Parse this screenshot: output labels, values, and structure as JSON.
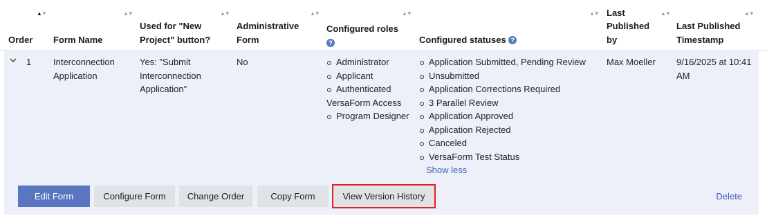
{
  "columns": [
    {
      "key": "order",
      "label": "Order",
      "sorted": "asc"
    },
    {
      "key": "form_name",
      "label": "Form Name"
    },
    {
      "key": "used_for",
      "label": "Used for \"New Project\" button?"
    },
    {
      "key": "administrative",
      "label": "Administrative Form"
    },
    {
      "key": "roles",
      "label": "Configured roles"
    },
    {
      "key": "statuses",
      "label": "Configured statuses"
    },
    {
      "key": "last_published_by",
      "label": "Last Published by"
    },
    {
      "key": "last_published_ts",
      "label": "Last Published Timestamp"
    }
  ],
  "row": {
    "order": "1",
    "form_name": "Interconnection Application",
    "used_for": "Yes: \"Submit Interconnection Application\"",
    "administrative": "No",
    "roles": [
      "Administrator",
      "Applicant",
      "Authenticated VersaForm Access",
      "Program Designer"
    ],
    "statuses": [
      "Application Submitted, Pending Review",
      "Unsubmitted",
      "Application Corrections Required",
      "3 Parallel Review",
      "Application Approved",
      "Application Rejected",
      "Canceled",
      "VersaForm Test Status"
    ],
    "show_less": "Show less",
    "last_published_by": "Max Moeller",
    "last_published_ts": "9/16/2025 at 10:41 AM"
  },
  "actions": {
    "edit_form": "Edit Form",
    "configure_form": "Configure Form",
    "change_order": "Change Order",
    "copy_form": "Copy Form",
    "view_version_history": "View Version History",
    "delete": "Delete"
  },
  "help_icon": "?",
  "colors": {
    "primary_button": "#5a76c0",
    "row_background": "#edf0f8",
    "link": "#3a63b6",
    "highlight": "#e02222"
  }
}
